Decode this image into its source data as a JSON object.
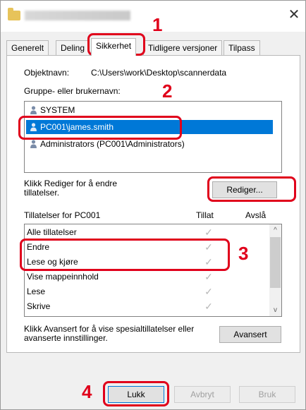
{
  "window": {
    "title": "Egenskaper for scannerdata",
    "close_glyph": "✕"
  },
  "tabs": [
    "Generelt",
    "Deling",
    "Sikkerhet",
    "Tidligere versjoner",
    "Tilpass"
  ],
  "object": {
    "label": "Objektnavn:",
    "value": "C:\\Users\\work\\Desktop\\scannerdata"
  },
  "groups": {
    "label": "Gruppe- eller brukernavn:",
    "items": [
      "SYSTEM",
      "PC001\\james.smith",
      "Administrators (PC001\\Administrators)"
    ],
    "selected_index": 1
  },
  "edit": {
    "hint": "Klikk Rediger for å endre tillatelser.",
    "button": "Rediger..."
  },
  "permissions": {
    "header_label": "Tillatelser for PC001",
    "col_allow": "Tillat",
    "col_deny": "Avslå",
    "rows": [
      "Alle tillatelser",
      "Endre",
      "Lese og kjøre",
      "Vise mappeinnhold",
      "Lese",
      "Skrive"
    ],
    "check_glyph": "✓",
    "scroll_up": "^",
    "scroll_down": "v"
  },
  "advanced": {
    "hint": "Klikk Avansert for å vise spesialtillatelser eller avanserte innstillinger.",
    "button": "Avansert"
  },
  "footer": {
    "ok": "Lukk",
    "cancel": "Avbryt",
    "apply": "Bruk"
  },
  "callouts": [
    "1",
    "2",
    "3",
    "4"
  ],
  "colors": {
    "callout": "#e0001b",
    "selection": "#0078d7"
  }
}
